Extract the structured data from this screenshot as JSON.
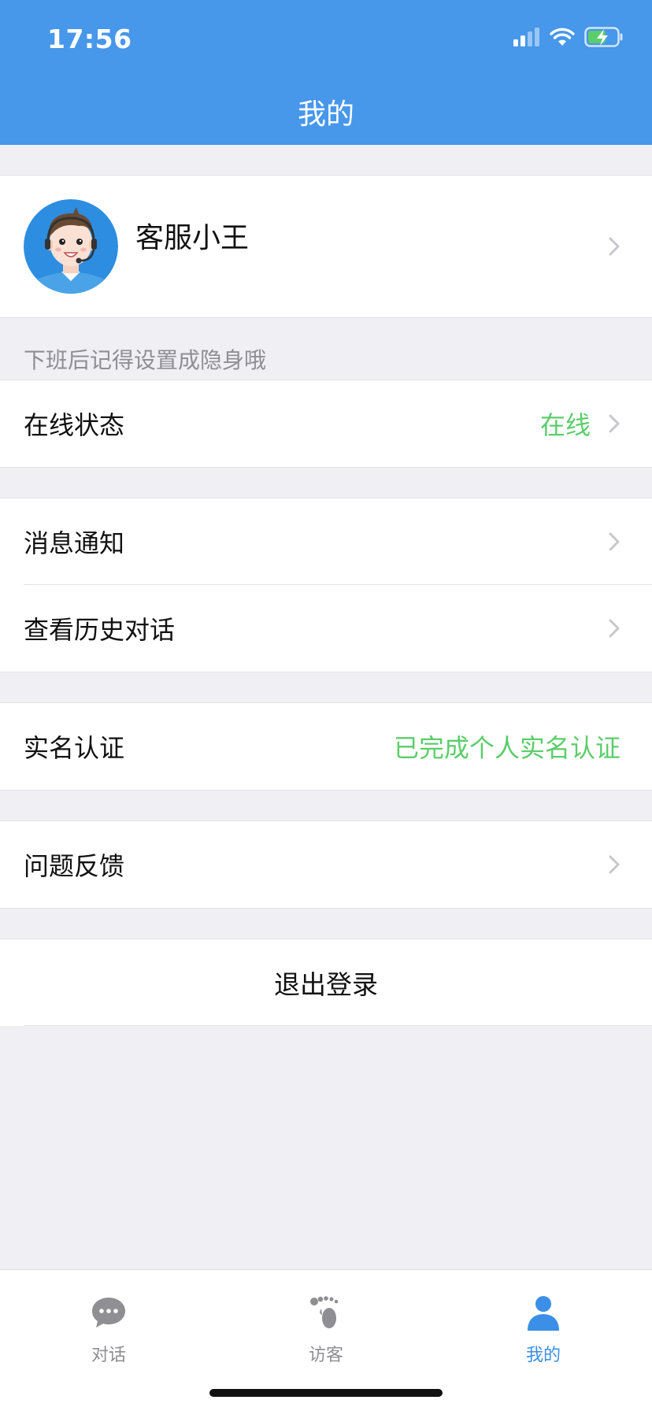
{
  "status_bar": {
    "time": "17:56",
    "icons": [
      "signal-icon",
      "wifi-icon",
      "battery-charging-icon"
    ]
  },
  "nav": {
    "title": "我的"
  },
  "profile": {
    "name": "客服小王",
    "avatar_icon": "agent-headset-avatar"
  },
  "hint": "下班后记得设置成隐身哦",
  "menu": {
    "online_status": {
      "label": "在线状态",
      "value": "在线"
    },
    "notifications": {
      "label": "消息通知"
    },
    "history": {
      "label": "查看历史对话"
    },
    "real_name": {
      "label": "实名认证",
      "value": "已完成个人实名认证"
    },
    "feedback": {
      "label": "问题反馈"
    },
    "logout": {
      "label": "退出登录"
    }
  },
  "tabs": [
    {
      "label": "对话",
      "icon": "chat-bubble-icon",
      "active": false
    },
    {
      "label": "访客",
      "icon": "footprint-icon",
      "active": false
    },
    {
      "label": "我的",
      "icon": "person-icon",
      "active": true
    }
  ],
  "colors": {
    "header": "#4797ea",
    "accent_green": "#5ccd6b",
    "tab_active": "#3b8fe6",
    "tab_inactive": "#8e8e93",
    "background": "#efeff4"
  }
}
